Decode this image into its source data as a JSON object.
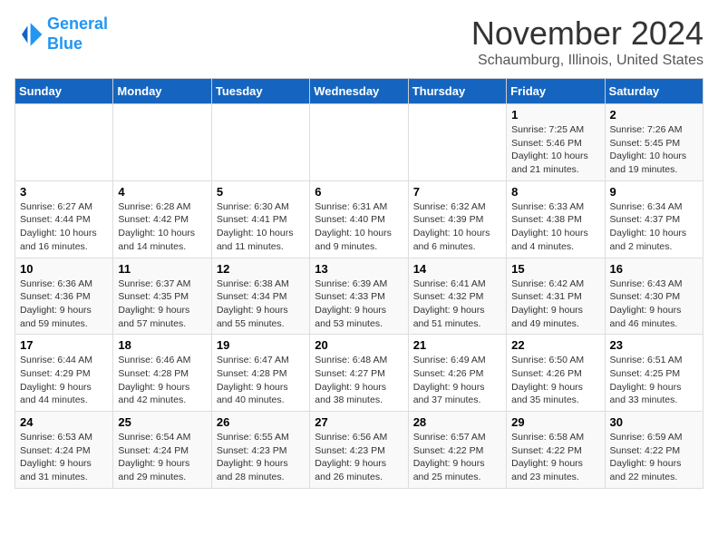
{
  "logo": {
    "line1": "General",
    "line2": "Blue"
  },
  "title": "November 2024",
  "location": "Schaumburg, Illinois, United States",
  "days_of_week": [
    "Sunday",
    "Monday",
    "Tuesday",
    "Wednesday",
    "Thursday",
    "Friday",
    "Saturday"
  ],
  "weeks": [
    [
      {
        "day": "",
        "sunrise": "",
        "sunset": "",
        "daylight": ""
      },
      {
        "day": "",
        "sunrise": "",
        "sunset": "",
        "daylight": ""
      },
      {
        "day": "",
        "sunrise": "",
        "sunset": "",
        "daylight": ""
      },
      {
        "day": "",
        "sunrise": "",
        "sunset": "",
        "daylight": ""
      },
      {
        "day": "",
        "sunrise": "",
        "sunset": "",
        "daylight": ""
      },
      {
        "day": "1",
        "sunrise": "Sunrise: 7:25 AM",
        "sunset": "Sunset: 5:46 PM",
        "daylight": "Daylight: 10 hours and 21 minutes."
      },
      {
        "day": "2",
        "sunrise": "Sunrise: 7:26 AM",
        "sunset": "Sunset: 5:45 PM",
        "daylight": "Daylight: 10 hours and 19 minutes."
      }
    ],
    [
      {
        "day": "3",
        "sunrise": "Sunrise: 6:27 AM",
        "sunset": "Sunset: 4:44 PM",
        "daylight": "Daylight: 10 hours and 16 minutes."
      },
      {
        "day": "4",
        "sunrise": "Sunrise: 6:28 AM",
        "sunset": "Sunset: 4:42 PM",
        "daylight": "Daylight: 10 hours and 14 minutes."
      },
      {
        "day": "5",
        "sunrise": "Sunrise: 6:30 AM",
        "sunset": "Sunset: 4:41 PM",
        "daylight": "Daylight: 10 hours and 11 minutes."
      },
      {
        "day": "6",
        "sunrise": "Sunrise: 6:31 AM",
        "sunset": "Sunset: 4:40 PM",
        "daylight": "Daylight: 10 hours and 9 minutes."
      },
      {
        "day": "7",
        "sunrise": "Sunrise: 6:32 AM",
        "sunset": "Sunset: 4:39 PM",
        "daylight": "Daylight: 10 hours and 6 minutes."
      },
      {
        "day": "8",
        "sunrise": "Sunrise: 6:33 AM",
        "sunset": "Sunset: 4:38 PM",
        "daylight": "Daylight: 10 hours and 4 minutes."
      },
      {
        "day": "9",
        "sunrise": "Sunrise: 6:34 AM",
        "sunset": "Sunset: 4:37 PM",
        "daylight": "Daylight: 10 hours and 2 minutes."
      }
    ],
    [
      {
        "day": "10",
        "sunrise": "Sunrise: 6:36 AM",
        "sunset": "Sunset: 4:36 PM",
        "daylight": "Daylight: 9 hours and 59 minutes."
      },
      {
        "day": "11",
        "sunrise": "Sunrise: 6:37 AM",
        "sunset": "Sunset: 4:35 PM",
        "daylight": "Daylight: 9 hours and 57 minutes."
      },
      {
        "day": "12",
        "sunrise": "Sunrise: 6:38 AM",
        "sunset": "Sunset: 4:34 PM",
        "daylight": "Daylight: 9 hours and 55 minutes."
      },
      {
        "day": "13",
        "sunrise": "Sunrise: 6:39 AM",
        "sunset": "Sunset: 4:33 PM",
        "daylight": "Daylight: 9 hours and 53 minutes."
      },
      {
        "day": "14",
        "sunrise": "Sunrise: 6:41 AM",
        "sunset": "Sunset: 4:32 PM",
        "daylight": "Daylight: 9 hours and 51 minutes."
      },
      {
        "day": "15",
        "sunrise": "Sunrise: 6:42 AM",
        "sunset": "Sunset: 4:31 PM",
        "daylight": "Daylight: 9 hours and 49 minutes."
      },
      {
        "day": "16",
        "sunrise": "Sunrise: 6:43 AM",
        "sunset": "Sunset: 4:30 PM",
        "daylight": "Daylight: 9 hours and 46 minutes."
      }
    ],
    [
      {
        "day": "17",
        "sunrise": "Sunrise: 6:44 AM",
        "sunset": "Sunset: 4:29 PM",
        "daylight": "Daylight: 9 hours and 44 minutes."
      },
      {
        "day": "18",
        "sunrise": "Sunrise: 6:46 AM",
        "sunset": "Sunset: 4:28 PM",
        "daylight": "Daylight: 9 hours and 42 minutes."
      },
      {
        "day": "19",
        "sunrise": "Sunrise: 6:47 AM",
        "sunset": "Sunset: 4:28 PM",
        "daylight": "Daylight: 9 hours and 40 minutes."
      },
      {
        "day": "20",
        "sunrise": "Sunrise: 6:48 AM",
        "sunset": "Sunset: 4:27 PM",
        "daylight": "Daylight: 9 hours and 38 minutes."
      },
      {
        "day": "21",
        "sunrise": "Sunrise: 6:49 AM",
        "sunset": "Sunset: 4:26 PM",
        "daylight": "Daylight: 9 hours and 37 minutes."
      },
      {
        "day": "22",
        "sunrise": "Sunrise: 6:50 AM",
        "sunset": "Sunset: 4:26 PM",
        "daylight": "Daylight: 9 hours and 35 minutes."
      },
      {
        "day": "23",
        "sunrise": "Sunrise: 6:51 AM",
        "sunset": "Sunset: 4:25 PM",
        "daylight": "Daylight: 9 hours and 33 minutes."
      }
    ],
    [
      {
        "day": "24",
        "sunrise": "Sunrise: 6:53 AM",
        "sunset": "Sunset: 4:24 PM",
        "daylight": "Daylight: 9 hours and 31 minutes."
      },
      {
        "day": "25",
        "sunrise": "Sunrise: 6:54 AM",
        "sunset": "Sunset: 4:24 PM",
        "daylight": "Daylight: 9 hours and 29 minutes."
      },
      {
        "day": "26",
        "sunrise": "Sunrise: 6:55 AM",
        "sunset": "Sunset: 4:23 PM",
        "daylight": "Daylight: 9 hours and 28 minutes."
      },
      {
        "day": "27",
        "sunrise": "Sunrise: 6:56 AM",
        "sunset": "Sunset: 4:23 PM",
        "daylight": "Daylight: 9 hours and 26 minutes."
      },
      {
        "day": "28",
        "sunrise": "Sunrise: 6:57 AM",
        "sunset": "Sunset: 4:22 PM",
        "daylight": "Daylight: 9 hours and 25 minutes."
      },
      {
        "day": "29",
        "sunrise": "Sunrise: 6:58 AM",
        "sunset": "Sunset: 4:22 PM",
        "daylight": "Daylight: 9 hours and 23 minutes."
      },
      {
        "day": "30",
        "sunrise": "Sunrise: 6:59 AM",
        "sunset": "Sunset: 4:22 PM",
        "daylight": "Daylight: 9 hours and 22 minutes."
      }
    ]
  ]
}
